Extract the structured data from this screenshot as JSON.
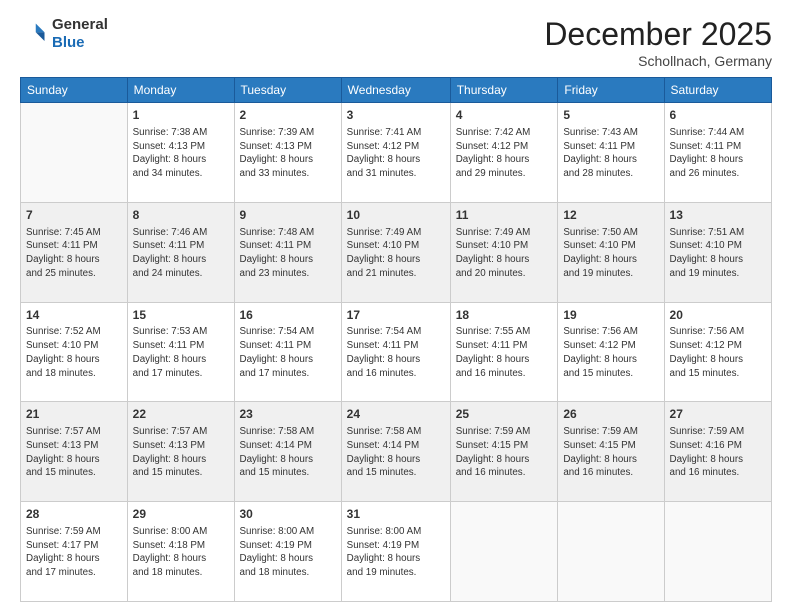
{
  "logo": {
    "general": "General",
    "blue": "Blue"
  },
  "header": {
    "month": "December 2025",
    "location": "Schollnach, Germany"
  },
  "weekdays": [
    "Sunday",
    "Monday",
    "Tuesday",
    "Wednesday",
    "Thursday",
    "Friday",
    "Saturday"
  ],
  "rows": [
    [
      {
        "day": "",
        "info": ""
      },
      {
        "day": "1",
        "info": "Sunrise: 7:38 AM\nSunset: 4:13 PM\nDaylight: 8 hours\nand 34 minutes."
      },
      {
        "day": "2",
        "info": "Sunrise: 7:39 AM\nSunset: 4:13 PM\nDaylight: 8 hours\nand 33 minutes."
      },
      {
        "day": "3",
        "info": "Sunrise: 7:41 AM\nSunset: 4:12 PM\nDaylight: 8 hours\nand 31 minutes."
      },
      {
        "day": "4",
        "info": "Sunrise: 7:42 AM\nSunset: 4:12 PM\nDaylight: 8 hours\nand 29 minutes."
      },
      {
        "day": "5",
        "info": "Sunrise: 7:43 AM\nSunset: 4:11 PM\nDaylight: 8 hours\nand 28 minutes."
      },
      {
        "day": "6",
        "info": "Sunrise: 7:44 AM\nSunset: 4:11 PM\nDaylight: 8 hours\nand 26 minutes."
      }
    ],
    [
      {
        "day": "7",
        "info": "Sunrise: 7:45 AM\nSunset: 4:11 PM\nDaylight: 8 hours\nand 25 minutes."
      },
      {
        "day": "8",
        "info": "Sunrise: 7:46 AM\nSunset: 4:11 PM\nDaylight: 8 hours\nand 24 minutes."
      },
      {
        "day": "9",
        "info": "Sunrise: 7:48 AM\nSunset: 4:11 PM\nDaylight: 8 hours\nand 23 minutes."
      },
      {
        "day": "10",
        "info": "Sunrise: 7:49 AM\nSunset: 4:10 PM\nDaylight: 8 hours\nand 21 minutes."
      },
      {
        "day": "11",
        "info": "Sunrise: 7:49 AM\nSunset: 4:10 PM\nDaylight: 8 hours\nand 20 minutes."
      },
      {
        "day": "12",
        "info": "Sunrise: 7:50 AM\nSunset: 4:10 PM\nDaylight: 8 hours\nand 19 minutes."
      },
      {
        "day": "13",
        "info": "Sunrise: 7:51 AM\nSunset: 4:10 PM\nDaylight: 8 hours\nand 19 minutes."
      }
    ],
    [
      {
        "day": "14",
        "info": "Sunrise: 7:52 AM\nSunset: 4:10 PM\nDaylight: 8 hours\nand 18 minutes."
      },
      {
        "day": "15",
        "info": "Sunrise: 7:53 AM\nSunset: 4:11 PM\nDaylight: 8 hours\nand 17 minutes."
      },
      {
        "day": "16",
        "info": "Sunrise: 7:54 AM\nSunset: 4:11 PM\nDaylight: 8 hours\nand 17 minutes."
      },
      {
        "day": "17",
        "info": "Sunrise: 7:54 AM\nSunset: 4:11 PM\nDaylight: 8 hours\nand 16 minutes."
      },
      {
        "day": "18",
        "info": "Sunrise: 7:55 AM\nSunset: 4:11 PM\nDaylight: 8 hours\nand 16 minutes."
      },
      {
        "day": "19",
        "info": "Sunrise: 7:56 AM\nSunset: 4:12 PM\nDaylight: 8 hours\nand 15 minutes."
      },
      {
        "day": "20",
        "info": "Sunrise: 7:56 AM\nSunset: 4:12 PM\nDaylight: 8 hours\nand 15 minutes."
      }
    ],
    [
      {
        "day": "21",
        "info": "Sunrise: 7:57 AM\nSunset: 4:13 PM\nDaylight: 8 hours\nand 15 minutes."
      },
      {
        "day": "22",
        "info": "Sunrise: 7:57 AM\nSunset: 4:13 PM\nDaylight: 8 hours\nand 15 minutes."
      },
      {
        "day": "23",
        "info": "Sunrise: 7:58 AM\nSunset: 4:14 PM\nDaylight: 8 hours\nand 15 minutes."
      },
      {
        "day": "24",
        "info": "Sunrise: 7:58 AM\nSunset: 4:14 PM\nDaylight: 8 hours\nand 15 minutes."
      },
      {
        "day": "25",
        "info": "Sunrise: 7:59 AM\nSunset: 4:15 PM\nDaylight: 8 hours\nand 16 minutes."
      },
      {
        "day": "26",
        "info": "Sunrise: 7:59 AM\nSunset: 4:15 PM\nDaylight: 8 hours\nand 16 minutes."
      },
      {
        "day": "27",
        "info": "Sunrise: 7:59 AM\nSunset: 4:16 PM\nDaylight: 8 hours\nand 16 minutes."
      }
    ],
    [
      {
        "day": "28",
        "info": "Sunrise: 7:59 AM\nSunset: 4:17 PM\nDaylight: 8 hours\nand 17 minutes."
      },
      {
        "day": "29",
        "info": "Sunrise: 8:00 AM\nSunset: 4:18 PM\nDaylight: 8 hours\nand 18 minutes."
      },
      {
        "day": "30",
        "info": "Sunrise: 8:00 AM\nSunset: 4:19 PM\nDaylight: 8 hours\nand 18 minutes."
      },
      {
        "day": "31",
        "info": "Sunrise: 8:00 AM\nSunset: 4:19 PM\nDaylight: 8 hours\nand 19 minutes."
      },
      {
        "day": "",
        "info": ""
      },
      {
        "day": "",
        "info": ""
      },
      {
        "day": "",
        "info": ""
      }
    ]
  ]
}
